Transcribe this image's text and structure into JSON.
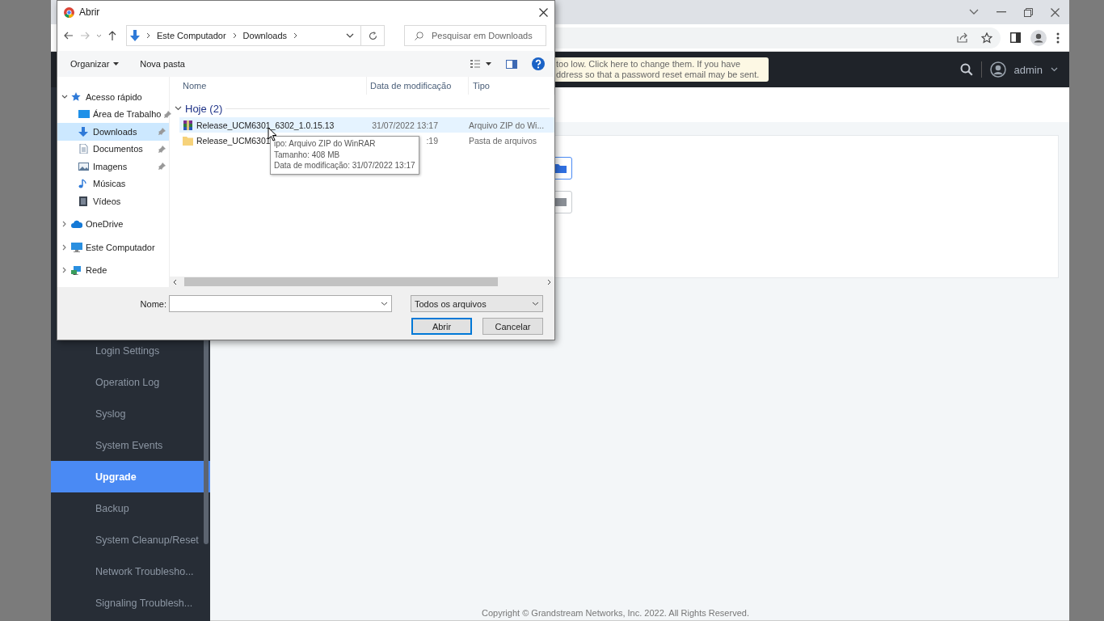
{
  "banner": {
    "lines": [
      "too low. Click here to change them. If you have",
      "ddress so that a password reset email may be sent."
    ]
  },
  "header": {
    "user": "admin"
  },
  "sidebar": {
    "items": [
      {
        "label": "Login Settings",
        "selected": false
      },
      {
        "label": "Operation Log",
        "selected": false
      },
      {
        "label": "Syslog",
        "selected": false
      },
      {
        "label": "System Events",
        "selected": false
      },
      {
        "label": "Upgrade",
        "selected": true
      },
      {
        "label": "Backup",
        "selected": false
      },
      {
        "label": "System Cleanup/Reset",
        "selected": false
      },
      {
        "label": "Network Troublesho...",
        "selected": false
      },
      {
        "label": "Signaling Troublesh...",
        "selected": false
      }
    ]
  },
  "footer": {
    "copyright": "Copyright © Grandstream Networks, Inc. 2022. All Rights Reserved."
  },
  "dialog": {
    "title": "Abrir",
    "breadcrumb": [
      "Este Computador",
      "Downloads"
    ],
    "search": {
      "placeholder": "Pesquisar em Downloads"
    },
    "toolbar": [
      "Organizar",
      "Nova pasta"
    ],
    "nav": [
      {
        "label": "Acesso rápido",
        "kind": "star",
        "expanded": true,
        "selected": false,
        "children": [
          {
            "label": "Área de Trabalho",
            "kind": "desktop",
            "pinned": true,
            "selected": false
          },
          {
            "label": "Downloads",
            "kind": "download",
            "pinned": true,
            "selected": true
          },
          {
            "label": "Documentos",
            "kind": "document",
            "pinned": true,
            "selected": false
          },
          {
            "label": "Imagens",
            "kind": "image",
            "pinned": true,
            "selected": false
          },
          {
            "label": "Músicas",
            "kind": "music",
            "pinned": false,
            "selected": false
          },
          {
            "label": "Vídeos",
            "kind": "video",
            "pinned": false,
            "selected": false
          }
        ]
      },
      {
        "label": "OneDrive",
        "kind": "cloud",
        "expanded": false,
        "selected": false
      },
      {
        "label": "Este Computador",
        "kind": "computer",
        "expanded": false,
        "selected": false
      },
      {
        "label": "Rede",
        "kind": "network",
        "expanded": false,
        "selected": false
      }
    ],
    "columns": [
      "Nome",
      "Data de modificação",
      "Tipo"
    ],
    "group": {
      "label": "Hoje (2)",
      "expanded": true
    },
    "files": [
      {
        "name": "Release_UCM6301_6302_1.0.15.13",
        "date": "31/07/2022 13:17",
        "type": "Arquivo ZIP do Wi...",
        "kind": "archive",
        "selected": true
      },
      {
        "name": "Release_UCM6301",
        "date": ":19",
        "type": "Pasta de arquivos",
        "kind": "folder",
        "selected": false
      }
    ],
    "tooltip": [
      "ipo: Arquivo ZIP do WinRAR",
      "Tamanho: 408 MB",
      "Data de modificação: 31/07/2022 13:17"
    ],
    "file_name": {
      "label": "Nome:"
    },
    "filter": "Todos os arquivos",
    "buttons": [
      {
        "label": "Abrir",
        "kind": "default"
      },
      {
        "label": "Cancelar",
        "kind": "normal"
      }
    ]
  }
}
